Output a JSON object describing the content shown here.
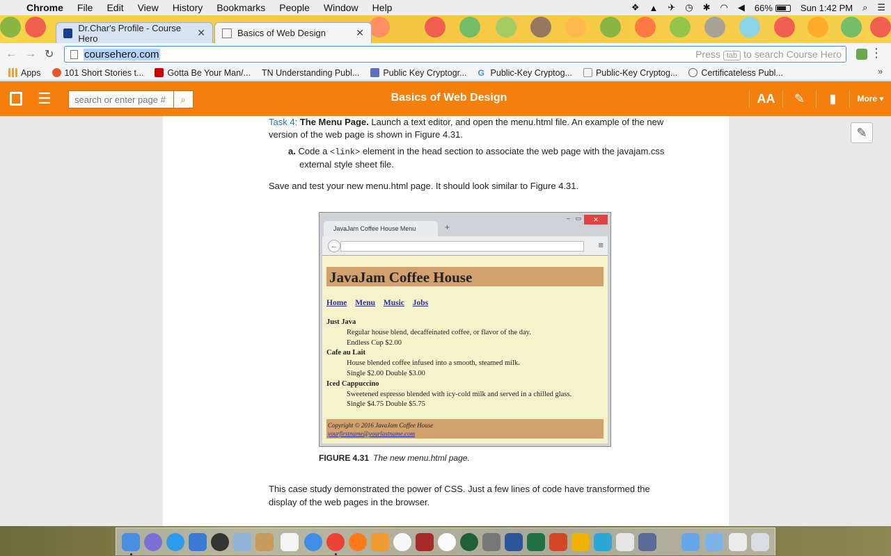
{
  "menubar": {
    "app": "Chrome",
    "items": [
      "File",
      "Edit",
      "View",
      "History",
      "Bookmarks",
      "People",
      "Window",
      "Help"
    ],
    "battery": "66%",
    "clock": "Sun 1:42 PM"
  },
  "tabs": [
    {
      "title": "Dr.Char's Profile - Course Hero",
      "active": false
    },
    {
      "title": "Basics of Web Design",
      "active": true
    }
  ],
  "address": {
    "url": "coursehero.com",
    "hint_pre": "Press",
    "hint_key": "tab",
    "hint_post": "to search Course Hero"
  },
  "bookmarks": [
    {
      "label": "Apps",
      "color": "#e8a13c"
    },
    {
      "label": "101 Short Stories t...",
      "color": "#e05a2a"
    },
    {
      "label": "Gotta Be Your Man/...",
      "color": "#cc0000"
    },
    {
      "label": "TN Understanding Publ...",
      "color": ""
    },
    {
      "label": "Public Key Cryptogr...",
      "color": "#5b6fbf"
    },
    {
      "label": "Public-Key Cryptog...",
      "color": "#4285f4"
    },
    {
      "label": "Public-Key Cryptog...",
      "color": "#999999"
    },
    {
      "label": "Certificateless Publ...",
      "color": "#666666"
    }
  ],
  "coursehero": {
    "search_placeholder": "search or enter page #",
    "title": "Basics of Web Design",
    "font_tool": "AA",
    "more": "More",
    "accent": "#f47f0c"
  },
  "doc": {
    "task_label": "Task 4:",
    "task_heading": "The Menu Page.",
    "task_text": " Launch a text editor, and open the menu.html file. An example of the new version of the web page is shown in Figure 4.31.",
    "step_letter": "a.",
    "step_pre": " Code a ",
    "step_code": "<link>",
    "step_post": " element in the head section to associate the web page with the javajam.css external style sheet file.",
    "save_text": "Save and test your new menu.html page. It should look similar to  Figure 4.31.",
    "closing": "This case study demonstrated the power of CSS. Just a few lines of code have transformed the display of the web pages in the browser."
  },
  "figure": {
    "tab_title": "JavaJam Coffee House Menu",
    "heading": "JavaJam Coffee House",
    "nav": [
      "Home",
      "Menu",
      "Music",
      "Jobs"
    ],
    "items": [
      {
        "name": "Just Java",
        "desc": "Regular house blend, decaffeinated coffee, or flavor of the day.",
        "price": "Endless Cup $2.00"
      },
      {
        "name": "Cafe au Lait",
        "desc": "House blended coffee infused into a smooth, steamed milk.",
        "price": "Single $2.00 Double $3.00"
      },
      {
        "name": "Iced Cappuccino",
        "desc": "Sweetened espresso blended with icy-cold milk and served in a chilled glass.",
        "price": "Single $4.75 Double $5.75"
      }
    ],
    "copyright": "Copyright © 2016 JavaJam Coffee House",
    "email": "yourfirstname@yourlastname.com",
    "caption_num": "FIGURE 4.31",
    "caption_text": "The new menu.html page."
  }
}
